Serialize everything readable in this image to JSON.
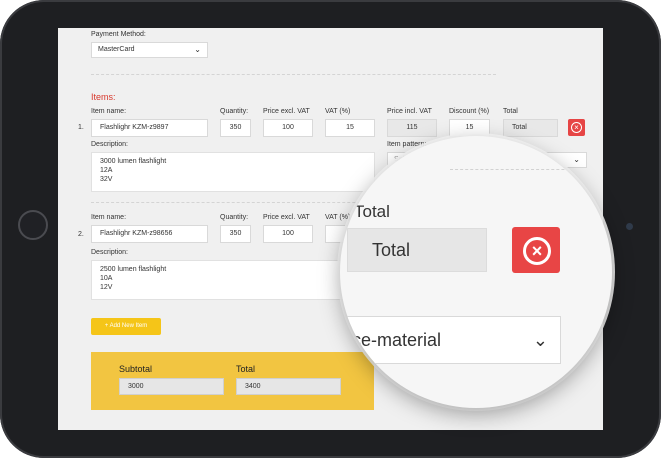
{
  "payment": {
    "label": "Payment Method:",
    "value": "MasterCard"
  },
  "items_title": "Items:",
  "columns": {
    "item_name": "Item name:",
    "quantity": "Quantity:",
    "price_excl": "Price excl. VAT",
    "vat": "VAT (%)",
    "price_incl": "Price incl. VAT",
    "discount": "Discount (%)",
    "total": "Total",
    "description": "Description:",
    "item_pattern": "Item pattern:"
  },
  "items": [
    {
      "index": "1.",
      "name": "Flashlighr KZM-z9897",
      "quantity": "350",
      "price_excl": "100",
      "vat": "15",
      "price_incl": "115",
      "discount": "15",
      "total": "Total",
      "description": [
        "3000 lumen flashlight",
        "12A",
        "32V"
      ],
      "pattern_placeholder": "Select"
    },
    {
      "index": "2.",
      "name": "Flashlighr KZM-z98656",
      "quantity": "350",
      "price_excl": "100",
      "vat": "15",
      "description": [
        "2500 lumen flashlight",
        "10A",
        "12V"
      ]
    }
  ],
  "add_item_label": "+ Add New Item",
  "summary": {
    "subtotal_label": "Subtotal",
    "subtotal_value": "3000",
    "total_label": "Total",
    "total_value": "3400"
  },
  "magnifier": {
    "total_label": "Total",
    "total_value": "Total",
    "pattern_value": "ce-material"
  },
  "icons": {
    "delete": "close-circle-icon",
    "dropdown": "chevron-down-icon",
    "add": "plus-icon"
  },
  "colors": {
    "accent_yellow": "#f2c541",
    "button_yellow": "#f5c518",
    "delete_red": "#e64545",
    "items_title_red": "#d8392e",
    "tablet_frame": "#1e1f22"
  }
}
